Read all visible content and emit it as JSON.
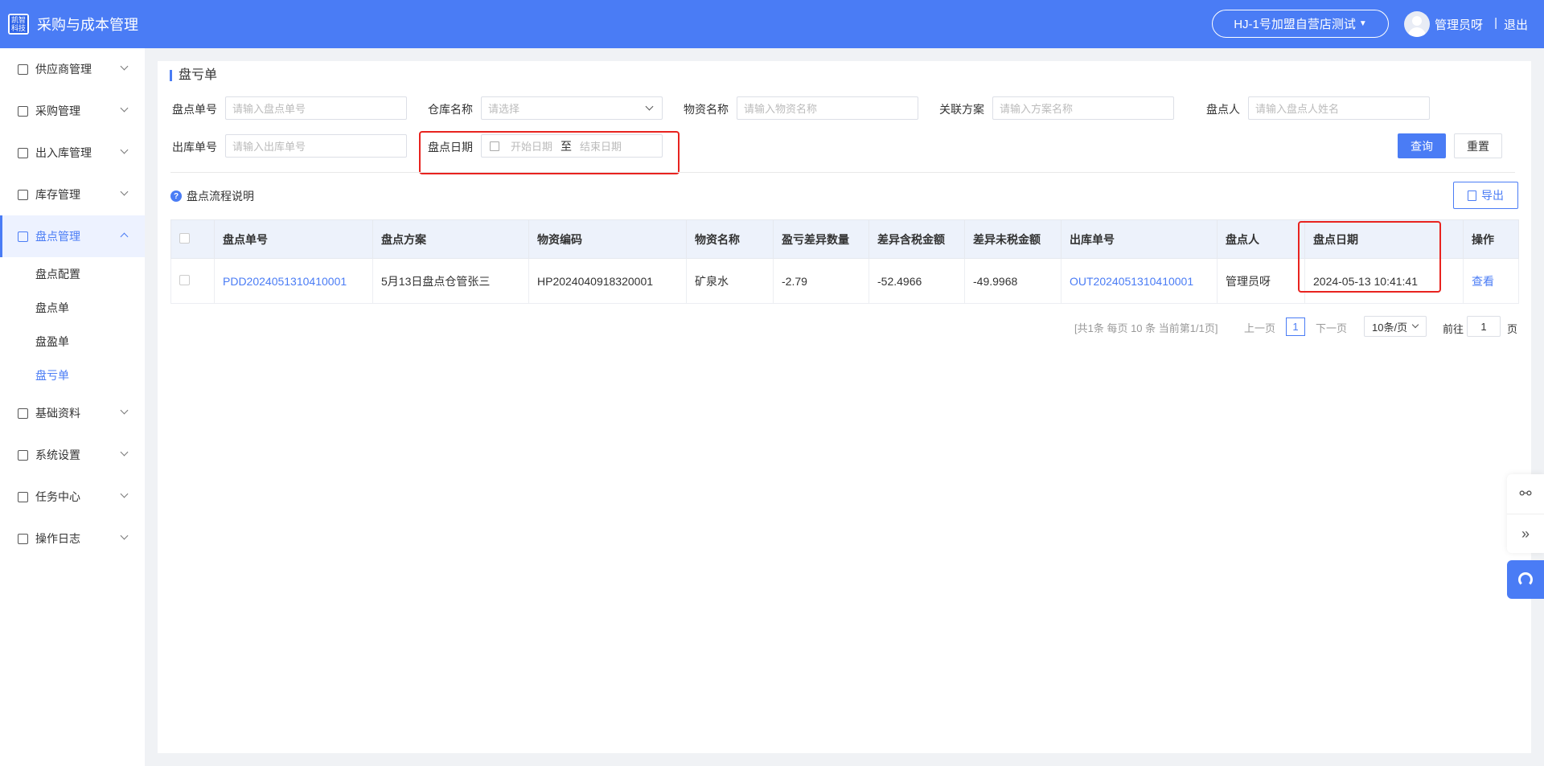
{
  "app": {
    "logo_text": "凯智科技",
    "title": "采购与成本管理",
    "store": "HJ-1号加盟自营店测试",
    "user_name": "管理员呀",
    "divider": "|",
    "logout": "退出"
  },
  "sidebar": {
    "items": [
      {
        "label": "供应商管理",
        "icon": "supplier-icon"
      },
      {
        "label": "采购管理",
        "icon": "purchase-icon"
      },
      {
        "label": "出入库管理",
        "icon": "stock-io-icon"
      },
      {
        "label": "库存管理",
        "icon": "inventory-icon"
      },
      {
        "label": "盘点管理",
        "icon": "stocktake-icon",
        "expanded": true
      },
      {
        "label": "基础资料",
        "icon": "basic-data-icon"
      },
      {
        "label": "系统设置",
        "icon": "settings-icon"
      },
      {
        "label": "任务中心",
        "icon": "task-icon"
      },
      {
        "label": "操作日志",
        "icon": "log-icon"
      }
    ],
    "sub_items": [
      "盘点配置",
      "盘点单",
      "盘盈单",
      "盘亏单"
    ],
    "current_sub": "盘亏单"
  },
  "page": {
    "title": "盘亏单",
    "filters": {
      "check_no": {
        "label": "盘点单号",
        "placeholder": "请输入盘点单号"
      },
      "warehouse": {
        "label": "仓库名称",
        "placeholder": "请选择"
      },
      "material": {
        "label": "物资名称",
        "placeholder": "请输入物资名称"
      },
      "plan": {
        "label": "关联方案",
        "placeholder": "请输入方案名称"
      },
      "checker": {
        "label": "盘点人",
        "placeholder": "请输入盘点人姓名"
      },
      "out_no": {
        "label": "出库单号",
        "placeholder": "请输入出库单号"
      },
      "date": {
        "label": "盘点日期",
        "start": "开始日期",
        "sep": "至",
        "end": "结束日期"
      }
    },
    "search_button": "查询",
    "reset_button": "重置",
    "help_text": "盘点流程说明",
    "export_button": "导出"
  },
  "table": {
    "headers": [
      "盘点单号",
      "盘点方案",
      "物资编码",
      "物资名称",
      "盈亏差异数量",
      "差异含税金额",
      "差异未税金额",
      "出库单号",
      "盘点人",
      "盘点日期",
      "操作"
    ],
    "rows": [
      {
        "check_no": "PDD2024051310410001",
        "plan": "5月13日盘点仓管张三",
        "material_code": "HP2024040918320001",
        "material_name": "矿泉水",
        "diff_qty": "-2.79",
        "diff_tax_amount": "-52.4966",
        "diff_notax_amount": "-49.9968",
        "out_no": "OUT2024051310410001",
        "checker": "管理员呀",
        "date": "2024-05-13 10:41:41",
        "action": "查看"
      }
    ]
  },
  "pagination": {
    "summary": "[共1条 每页 10 条 当前第1/1页]",
    "prev": "上一页",
    "current": "1",
    "next": "下一页",
    "page_size": "10条/页",
    "goto_prefix": "前往",
    "goto_value": "1",
    "goto_suffix": "页"
  },
  "float_tools": {
    "link": "⚯",
    "collapse": "»"
  },
  "colors": {
    "primary": "#4a7cf5",
    "highlight_box": "#e8231f"
  }
}
